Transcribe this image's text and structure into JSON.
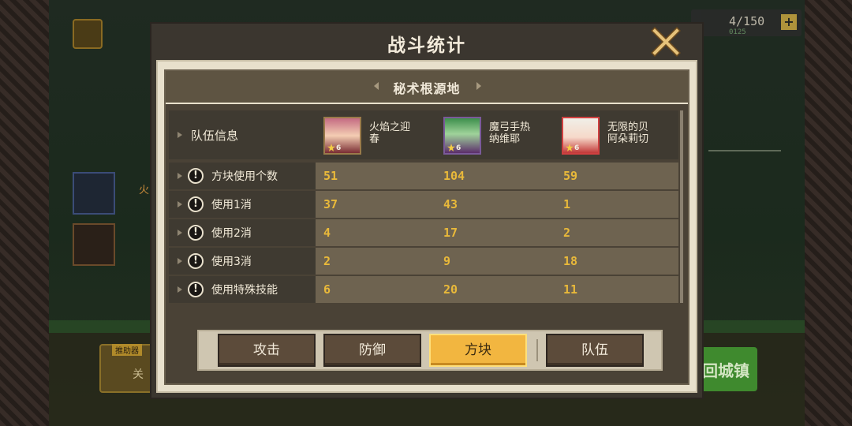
{
  "modal": {
    "title": "战斗统计",
    "location": "秘术根源地"
  },
  "team": {
    "header_label": "队伍信息",
    "heroes": [
      {
        "name": "火焰之迎春",
        "stars": 6,
        "level_shown": "6"
      },
      {
        "name": "魔弓手热纳维耶",
        "stars": 6,
        "level_shown": "6"
      },
      {
        "name": "无限的贝阿朵莉切",
        "stars": 6,
        "level_shown": "6"
      }
    ]
  },
  "stats": [
    {
      "label": "方块使用个数",
      "values": [
        "51",
        "104",
        "59"
      ]
    },
    {
      "label": "使用1消",
      "values": [
        "37",
        "43",
        "1"
      ]
    },
    {
      "label": "使用2消",
      "values": [
        "4",
        "17",
        "2"
      ]
    },
    {
      "label": "使用3消",
      "values": [
        "2",
        "9",
        "18"
      ]
    },
    {
      "label": "使用特殊技能",
      "values": [
        "6",
        "20",
        "11"
      ]
    }
  ],
  "tabs": [
    {
      "label": "攻击",
      "active": false
    },
    {
      "label": "防御",
      "active": false
    },
    {
      "label": "方块",
      "active": true
    },
    {
      "label": "队伍",
      "active": false
    }
  ],
  "background": {
    "counter_value": "4/150",
    "counter_timer": "0125",
    "left_button_tag": "推助器",
    "left_button_text": "关",
    "side_label": "火",
    "right_button_text": "回城镇"
  },
  "colors": {
    "value_text": "#e9b93a",
    "active_tab": "#f2b640",
    "panel_bg": "#e8e0cc",
    "modal_frame": "#3b362f"
  }
}
